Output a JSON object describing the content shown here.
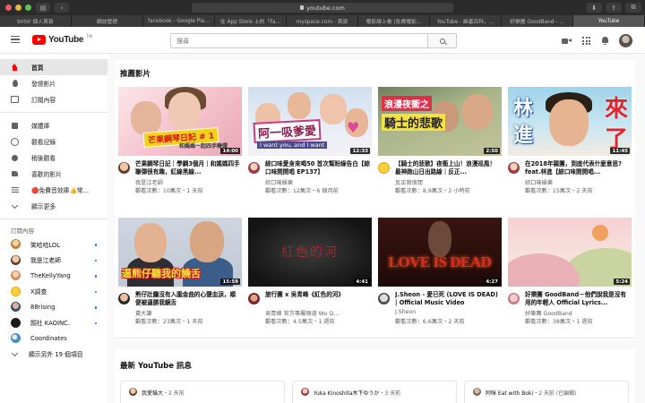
{
  "browser": {
    "url": "youtube.com",
    "tabs": [
      {
        "label": "birbir 個人首頁",
        "active": false
      },
      {
        "label": "網誌管理",
        "active": false
      },
      {
        "label": "facebook - Google Pla...",
        "active": false
      },
      {
        "label": "在 App Store 上的「Fa...",
        "active": false
      },
      {
        "label": "myspace.com - 首頁",
        "active": false
      },
      {
        "label": "電影線上看 (免費電影...",
        "active": false
      },
      {
        "label": "YouTube - 維基百科，...",
        "active": false
      },
      {
        "label": "好樂團 GoodBand - ...",
        "active": false
      },
      {
        "label": "YouTube",
        "active": true
      }
    ]
  },
  "header": {
    "logo_text": "YouTube",
    "logo_region": "TW",
    "search_placeholder": "搜尋"
  },
  "sidebar": {
    "main_items": [
      {
        "label": "首頁",
        "icon": "home-icon",
        "active": true
      },
      {
        "label": "發燒影片",
        "icon": "trending-icon",
        "active": false
      },
      {
        "label": "訂閱內容",
        "icon": "subscriptions-icon",
        "active": false
      }
    ],
    "library_items": [
      {
        "label": "媒體庫",
        "icon": "library-icon"
      },
      {
        "label": "觀看記錄",
        "icon": "history-icon"
      },
      {
        "label": "稍後觀看",
        "icon": "watch-later-icon"
      },
      {
        "label": "喜歡的影片",
        "icon": "liked-videos-icon"
      },
      {
        "label": "🔴免費音效庫👍常...",
        "icon": "playlist-icon"
      },
      {
        "label": "顯示更多",
        "icon": "show-more-icon"
      }
    ],
    "subscriptions_heading": "訂閱內容",
    "subscriptions": [
      {
        "label": "笑哈哈LOL",
        "dot": true
      },
      {
        "label": "我是江老師",
        "dot": true
      },
      {
        "label": "TheKellyYang",
        "dot": true
      },
      {
        "label": "X調查",
        "dot": true
      },
      {
        "label": "88rising",
        "dot": true
      },
      {
        "label": "顏社 KAOINC.",
        "dot": true
      },
      {
        "label": "Coordinates",
        "dot": false
      }
    ],
    "show_more_subs": "顯示另外 19 個項目"
  },
  "recommended": {
    "title": "推薦影片",
    "videos": [
      {
        "title": "芒果鋼琴日記｜學鋼3個月｜和媽媽四手聯彈很有趣，紅線黑線...",
        "channel": "我是江老師",
        "stats": "觀看次數：10萬次・1 天前",
        "duration": "14:00",
        "thumb_text": "芒果鋼琴日記 # 1",
        "thumb_sub": "和媽媽一起四手聯彈"
      },
      {
        "title": "綜口味愛身來喝50 首次幫盼綠告白【綜口味開開唱 EP137】",
        "channel": "綜口味娛樂",
        "stats": "觀看次數：12萬次・6 個月前",
        "duration": "12:33",
        "thumb_text": "阿一吸爹愛",
        "thumb_sub": "I want you, and I want"
      },
      {
        "title": "【騎士的悲歌】夜衝上山！浪漫巡風！最神跑山日出路線｜反正...",
        "channel": "反正我很閒",
        "stats": "觀看次數：8.9萬次・2 小時前",
        "duration": "2:50",
        "thumb_text": "浪漫夜衝之",
        "thumb_sub": "騎士的悲歌"
      },
      {
        "title": "在2018年親團，到底代表什麼意思?feat.林進【綜口味開開唱...",
        "channel": "綜口味娛樂",
        "stats": "觀看次數：15萬次・2 天前",
        "duration": "11:45",
        "thumb_text": [
          "林",
          "進",
          "來",
          "了"
        ],
        "thumb_sub": ""
      },
      {
        "title": "熊仔壯膽沒有入圍金曲的心聲血淚，順便被逼勝我鏡舌",
        "channel": "黃大謙",
        "stats": "觀看次數：23萬次・1 天前",
        "duration": "15:59",
        "thumb_text": "逼熊仔聽我的饒舌",
        "thumb_sub": ""
      },
      {
        "title": "旅行團 x 吳青峰《紅色的河》",
        "channel": "吳青峰 官方專屬頻道 Wu Q...",
        "stats": "觀看次數：4.5萬次・1 週前",
        "duration": "4:41",
        "thumb_text": "紅色的河",
        "thumb_sub": ""
      },
      {
        "title": "J.Sheon - 愛已死 (LOVE IS DEAD) | Official Music Video",
        "channel": "J.Sheon",
        "stats": "觀看次數：6.6萬次・2 天前",
        "duration": "4:27",
        "thumb_text": "LOVE IS DEAD",
        "thumb_sub": ""
      },
      {
        "title": "好樂團 GoodBand－他們說我是沒有用的年輕人 Official Lyrics...",
        "channel": "好樂團 GoodBand",
        "stats": "觀看次數：38萬次・1 週前",
        "duration": "5:24",
        "thumb_text": "",
        "thumb_sub": ""
      }
    ]
  },
  "latest_news": {
    "title": "最新 YouTube 訊息",
    "cards": [
      {
        "author": "我愛貓大",
        "time": "・2 天前"
      },
      {
        "author": "Yuka Kinoshita木下ゆうか",
        "time": "・3 天前"
      },
      {
        "author": "阿咪 Eat with Boki",
        "time": "・2 天前 (已編輯)"
      }
    ]
  }
}
